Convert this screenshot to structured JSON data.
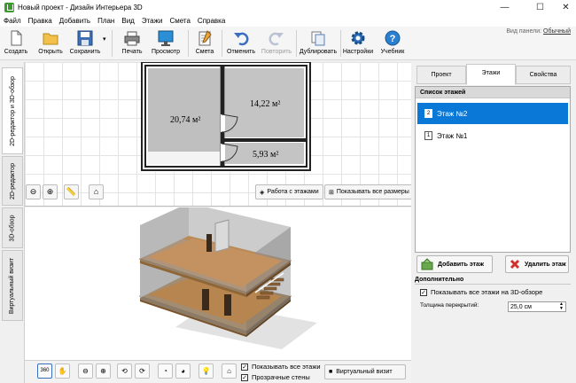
{
  "window": {
    "title": "Новый проект - Дизайн Интерьера 3D",
    "minimize": "—",
    "maximize": "☐",
    "close": "✕"
  },
  "menu": [
    "Файл",
    "Правка",
    "Добавить",
    "План",
    "Вид",
    "Этажи",
    "Смета",
    "Справка"
  ],
  "toolbar": {
    "create": "Создать",
    "open": "Открыть",
    "save": "Сохранить",
    "save_arrow": "▾",
    "print": "Печать",
    "preview": "Просмотр",
    "estimate": "Смета",
    "undo": "Отменить",
    "redo": "Повторить",
    "duplicate": "Дублировать",
    "settings": "Настройки",
    "tutorial": "Учебник"
  },
  "view_mode": {
    "label": "Вид панели:",
    "value": "Обычный"
  },
  "side_tabs": [
    "2D-редактор и 3D-обзор",
    "2D-редактор",
    "3D-обзор",
    "Виртуальный визит"
  ],
  "plan": {
    "rooms": [
      {
        "area": "20,74 м²"
      },
      {
        "area": "14,22 м²"
      },
      {
        "area": "5,93 м²"
      }
    ],
    "floors_button": "Работа с этажами",
    "sizes_button": "Показывать все размеры"
  },
  "right_panel": {
    "tabs": [
      "Проект",
      "Этажи",
      "Свойства"
    ],
    "active_tab": "Этажи",
    "list_title": "Список этажей",
    "floors": [
      {
        "label": "Этаж №2",
        "num": "2",
        "selected": true
      },
      {
        "label": "Этаж №1",
        "num": "1",
        "selected": false
      }
    ],
    "add_floor": "Добавить этаж",
    "delete_floor": "Удалить этаж",
    "additional": "Дополнительно",
    "show_all_3d": "Показывать все этажи на 3D-обзоре",
    "show_all_3d_checked": true,
    "thickness_label": "Толщина перекрытий:",
    "thickness_value": "25,0 см"
  },
  "bottom": {
    "show_all_floors": "Показывать все этажи",
    "transparent_walls": "Прозрачные стены",
    "virtual_visit": "Виртуальный визит",
    "view360": "360"
  },
  "colors": {
    "selection": "#0a78d6",
    "floor_wood": "#b08050",
    "room_fill": "#bfbfbf"
  }
}
